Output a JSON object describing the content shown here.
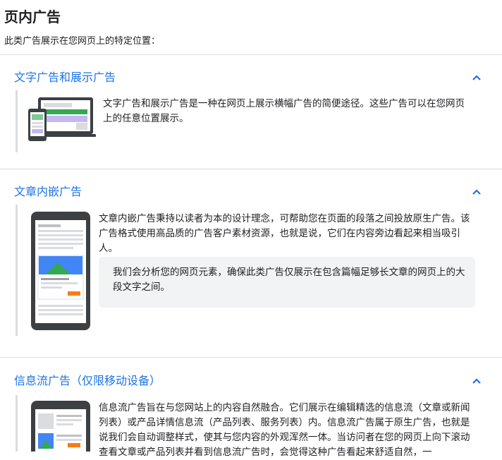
{
  "page": {
    "title": "页内广告",
    "subtitle": "此类广告展示在您网页上的特定位置："
  },
  "sections": [
    {
      "title": "文字广告和展示广告",
      "description": "文字广告和展示广告是一种在网页上展示横幅广告的简便途径。这些广告可以在您网页上的任意位置展示。"
    },
    {
      "title": "文章内嵌广告",
      "description": "文章内嵌广告秉持以读者为本的设计理念，可帮助您在页面的段落之间投放原生广告。该广告格式使用高品质的广告客户素材资源，也就是说，它们在内容旁边看起来相当吸引人。",
      "note": "我们会分析您的网页元素，确保此类广告仅展示在包含篇幅足够长文章的网页上的大段文字之间。"
    },
    {
      "title": "信息流广告（仅限移动设备）",
      "description": "信息流广告旨在与您网站上的内容自然融合。它们展示在编辑精选的信息流（文章或新闻列表）或产品详情信息流（产品列表、服务列表）内。信息流广告属于原生广告，也就是说我们会自动调整样式，使其与您内容的外观浑然一体。当访问者在您的网页上向下滚动查看文章或产品列表并看到信息流广告时，会觉得这种广告看起来舒适自然，一"
    }
  ],
  "icons": {
    "chevron": "chevron-up-icon",
    "section1_illustration": "devices-display-ad-icon",
    "section2_illustration": "phone-in-article-ad-icon",
    "section3_illustration": "phone-in-feed-ad-icon"
  },
  "colors": {
    "link_blue": "#1a73e8",
    "divider": "#dadce0",
    "note_bg": "#f1f3f4"
  }
}
